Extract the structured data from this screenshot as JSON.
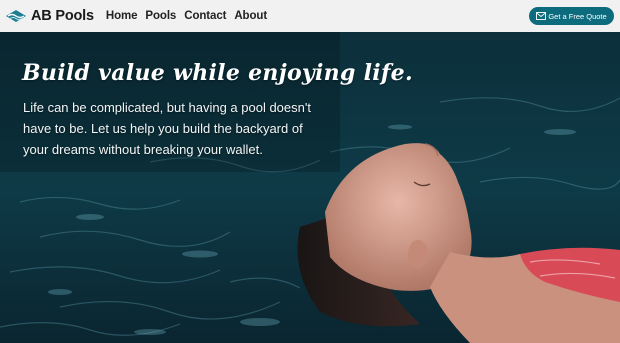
{
  "header": {
    "brand": "AB Pools",
    "logo_icon": "wave-logo-icon",
    "nav": [
      "Home",
      "Pools",
      "Contact",
      "About"
    ],
    "cta_label": "Get a Free Quote",
    "cta_icon": "envelope-icon"
  },
  "hero": {
    "title": "Build value while enjoying life.",
    "text": "Life can be complicated, but having a pool doesn't have to be. Let us help you build the backyard of your dreams without breaking your wallet.",
    "image": "woman-floating-in-pool-photo"
  },
  "colors": {
    "navbar_bg": "#f1f1f1",
    "accent": "#0d6b7e",
    "water": "#0b2b36"
  }
}
